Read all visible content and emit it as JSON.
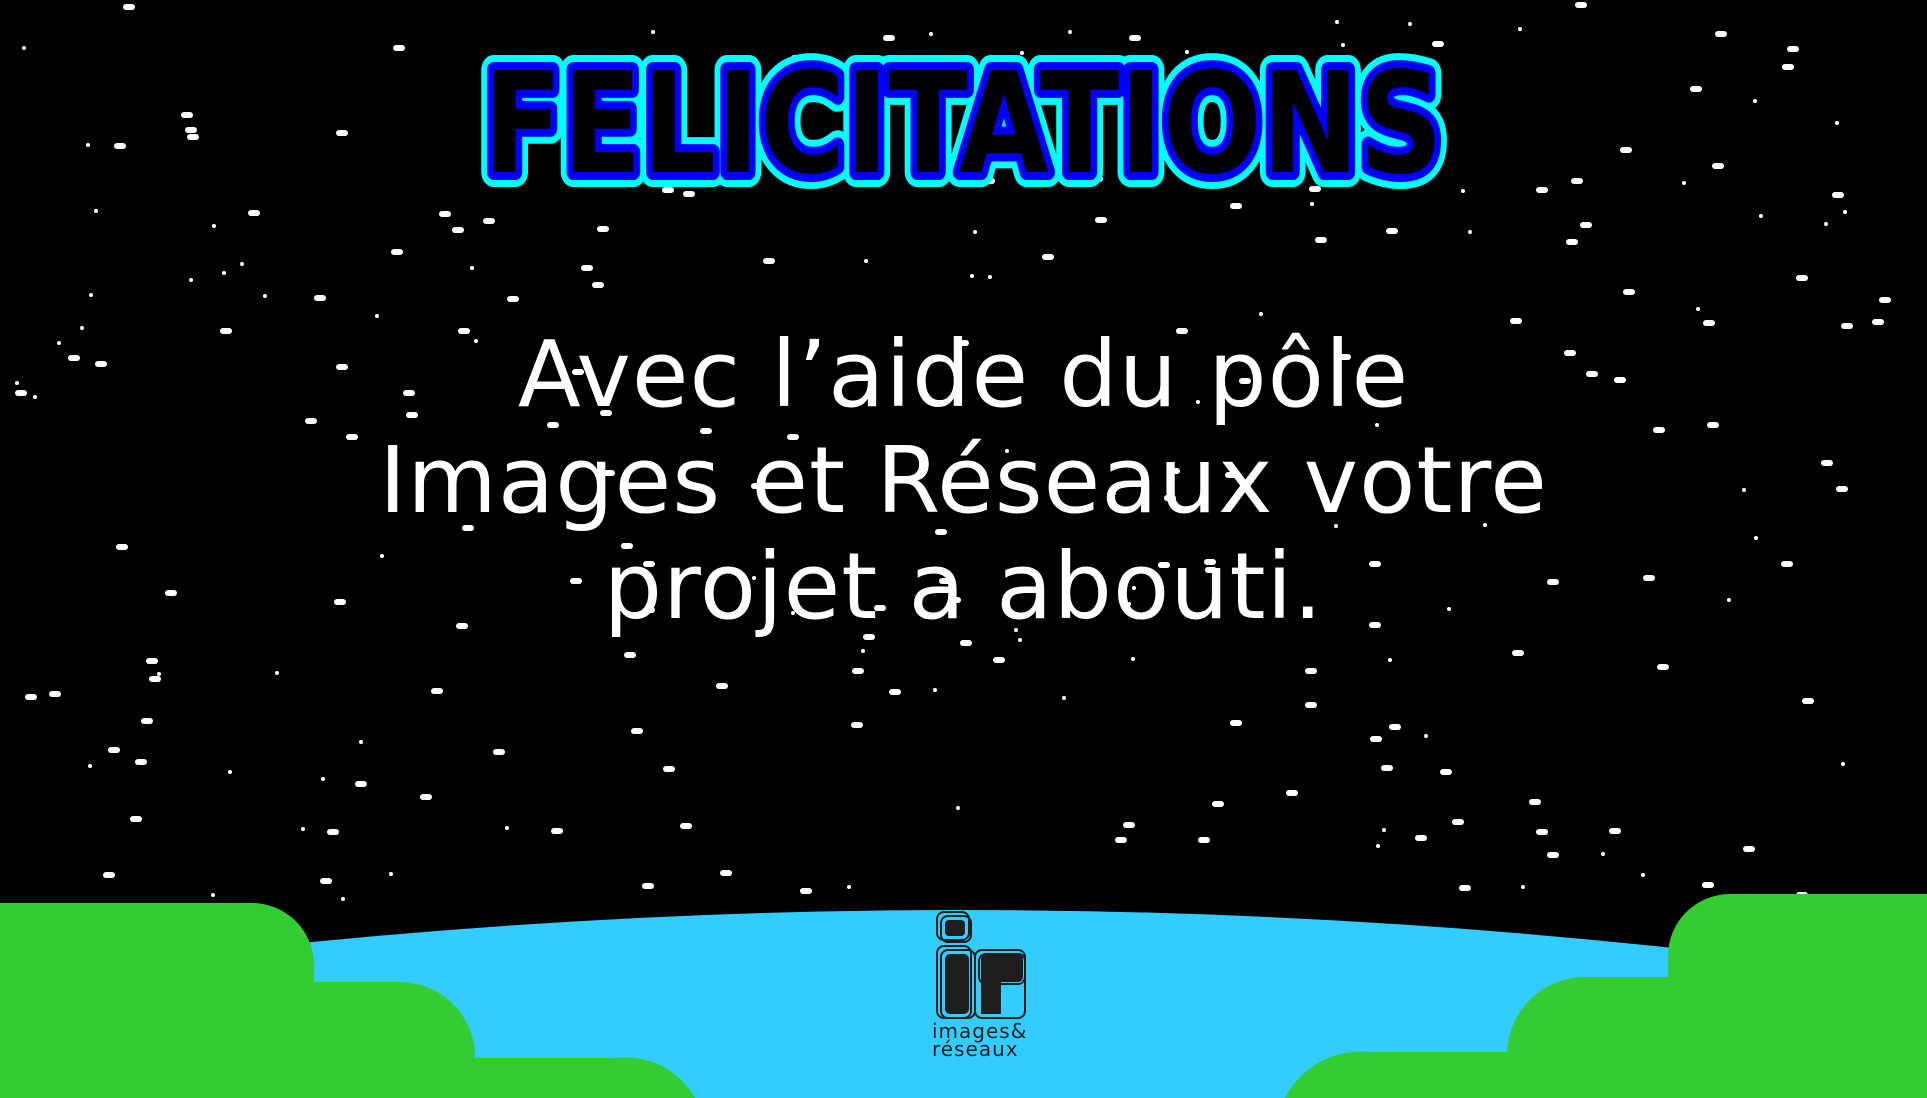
{
  "title": "FELICITATIONS",
  "message": {
    "lines": [
      "Avec l’aide du pôle",
      "Images et Réseaux votre",
      "projet a abouti."
    ]
  },
  "logo": {
    "mark": "ir",
    "line1": "images&",
    "line2": "réseaux"
  },
  "colors": {
    "sky": "#000000",
    "planet": "#33CCFF",
    "hills": "#33CC33",
    "title_outer": "#00FFFF",
    "title_inner": "#0000FF"
  }
}
